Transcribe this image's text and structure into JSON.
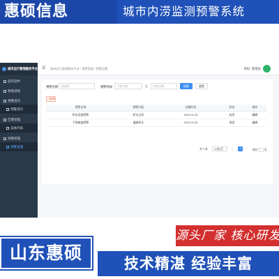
{
  "banner": {
    "brand": "惠硕信息",
    "title": "城市内涝监测预警系统"
  },
  "app": {
    "platform_title": "城市运行管理服务平台",
    "sidebar": {
      "items": [
        {
          "label": "城市部件",
          "icon": "grid-icon"
        },
        {
          "label": "物联感知",
          "icon": "grid-icon"
        },
        {
          "label": "预警提示",
          "icon": "grid-icon"
        },
        {
          "label": "预警提示",
          "icon": "list-icon",
          "sub": true
        },
        {
          "label": "告警管理",
          "icon": "grid-icon"
        },
        {
          "label": "设备列表",
          "icon": "list-icon",
          "sub": true
        },
        {
          "label": "预警管理",
          "icon": "grid-icon"
        },
        {
          "label": "预警设置",
          "icon": "edit-icon",
          "sub": true,
          "active": true
        }
      ]
    },
    "topbar": {
      "breadcrumb": "城市运行管理服务平台 / 预警管理 / 预警设置",
      "user": "你好, 管理员"
    },
    "filters": {
      "name_label": "预警名称",
      "name_placeholder": "请选择",
      "time_label": "预警时间",
      "start_placeholder": "开始日期",
      "to": "至",
      "end_placeholder": "结束日期",
      "search": "搜索",
      "reset": "重置"
    },
    "add_button": "+ 新增",
    "table": {
      "headers": [
        "预警名称",
        "预警内容",
        "创建时间",
        "状态",
        "操作"
      ],
      "rows": [
        {
          "name": "积水深度预警",
          "content": "积水过深",
          "time": "2023-01-05",
          "status": "启用",
          "status_color": "red",
          "action": "编辑"
        },
        {
          "name": "下穿隧道预警",
          "content": "道路积水",
          "time": "2023-01-05",
          "status": "停用",
          "status_color": "green",
          "action": "编辑"
        }
      ]
    },
    "pager": {
      "total": "共 2 条",
      "size": "10条/页",
      "prev": "<",
      "page": "1",
      "next": ">",
      "goto": "前往",
      "unit": "页"
    }
  },
  "promo": {
    "slogan_small": "源头厂家 核心研发",
    "company": "山东惠硕",
    "slogan_big": "技术精湛 经验丰富"
  },
  "colors": {
    "brand_blue": "#1f51b8",
    "accent_red": "#d32f2f",
    "sidebar": "#2b3a4b",
    "primary_button": "#3d8ff0"
  }
}
